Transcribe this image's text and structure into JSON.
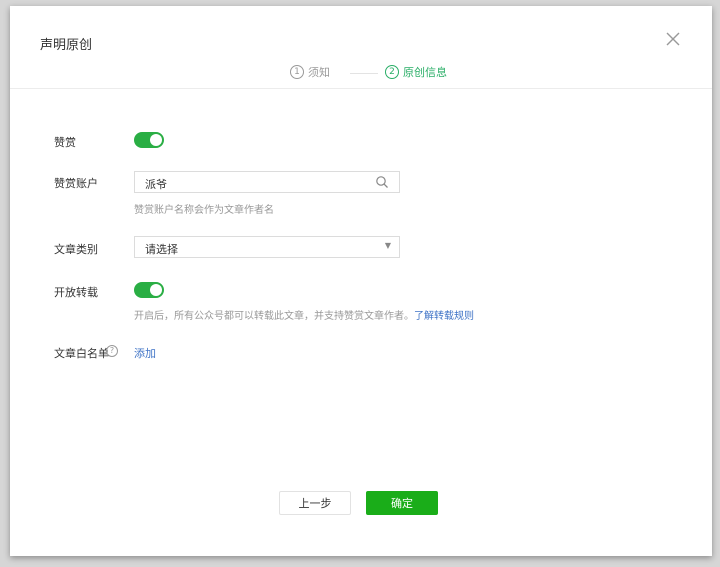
{
  "dialog": {
    "title": "声明原创",
    "close_icon": "close-icon"
  },
  "steps": [
    {
      "num": "1",
      "label": "须知",
      "state": "done"
    },
    {
      "num": "2",
      "label": "原创信息",
      "state": "active"
    }
  ],
  "form": {
    "reward": {
      "label": "赞赏",
      "toggle_on": true
    },
    "reward_account": {
      "label": "赞赏账户",
      "value": "派爷",
      "icon": "search-icon",
      "helper": "赞赏账户名称会作为文章作者名"
    },
    "category": {
      "label": "文章类别",
      "value": "请选择"
    },
    "allow_repost": {
      "label": "开放转载",
      "toggle_on": true,
      "helper": "开启后，所有公众号都可以转载此文章，并支持赞赏文章作者。",
      "link": "了解转载规则"
    },
    "whitelist": {
      "label": "文章白名单",
      "help_icon": "?",
      "add_link": "添加"
    }
  },
  "footer": {
    "prev_label": "上一步",
    "ok_label": "确定"
  },
  "colors": {
    "accent_green": "#1aad19",
    "toggle_green": "#2aae44",
    "step_active": "#2aae67",
    "link_blue": "#3f73c6"
  }
}
